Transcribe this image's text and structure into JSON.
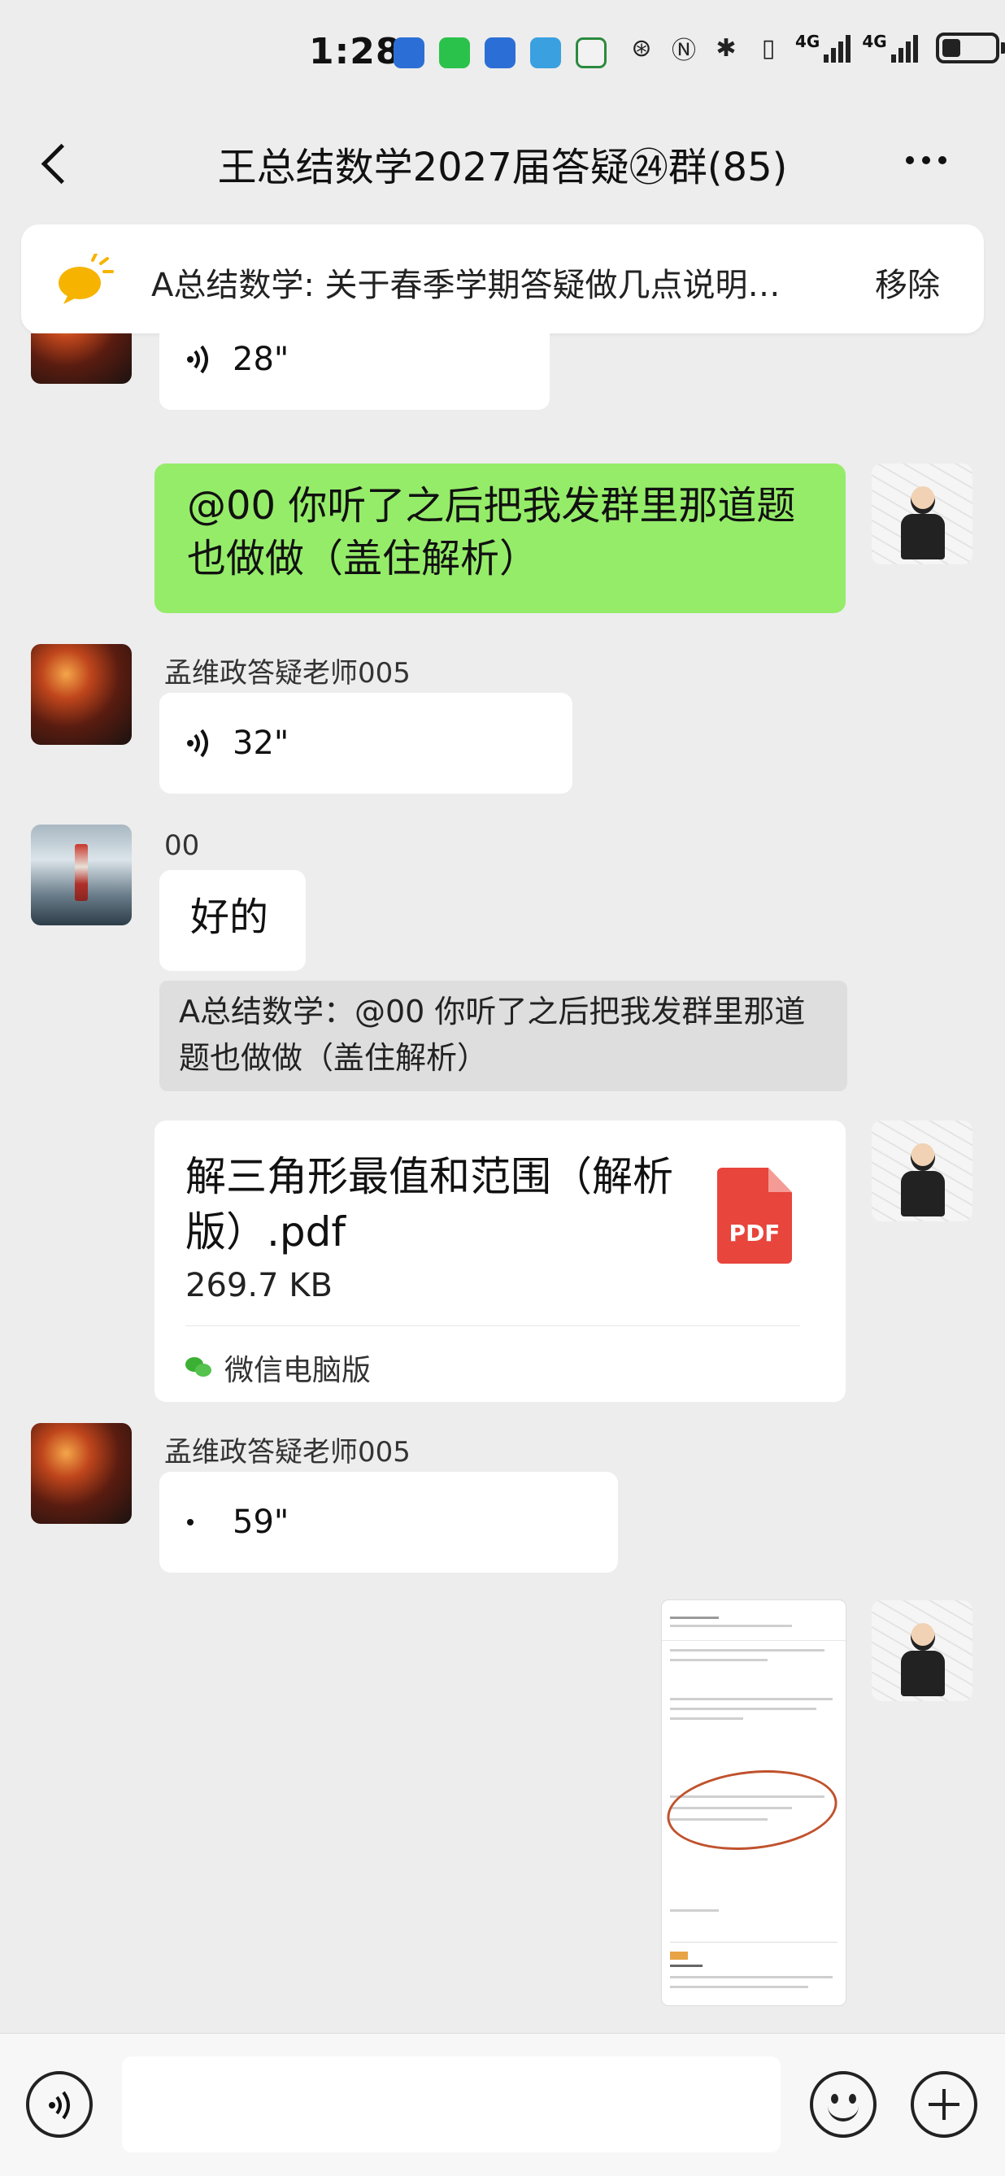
{
  "status_bar": {
    "time": "1:28",
    "signal_1_label": "4G",
    "signal_2_label": "4G",
    "battery_level": 0.35
  },
  "header": {
    "title": "王总结数学2027届答疑㉔群(85)"
  },
  "pinned": {
    "text": "A总结数学: 关于春季学期答疑做几点说明…",
    "remove_label": "移除"
  },
  "messages": {
    "voice_28": {
      "duration": "28\""
    },
    "green_text": {
      "text": "@00 你听了之后把我发群里那道题也做做（盖住解析）"
    },
    "voice_32": {
      "sender": "孟维政答疑老师005",
      "duration": "32\""
    },
    "reply_ok": {
      "sender": "00",
      "text": "好的",
      "quote": "A总结数学：@00 你听了之后把我发群里那道题也做做（盖住解析）"
    },
    "file": {
      "name": "解三角形最值和范围（解析版）.pdf",
      "size": "269.7 KB",
      "badge": "PDF",
      "source": "微信电脑版"
    },
    "voice_59": {
      "sender": "孟维政答疑老师005",
      "duration": "59\""
    }
  },
  "colors": {
    "chat_bg": "#ededed",
    "my_bubble": "#95ec69",
    "pdf_red": "#e8453c"
  }
}
